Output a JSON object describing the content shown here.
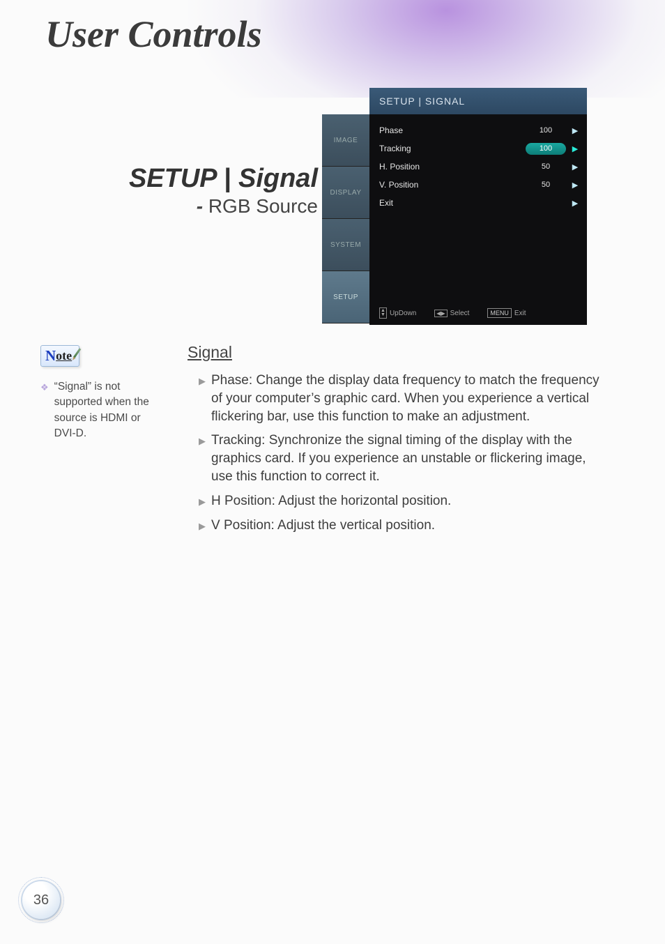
{
  "banner": {
    "title": "User Controls"
  },
  "section": {
    "heading": "SETUP | Signal",
    "sub_dash": "-",
    "sub": " RGB Source"
  },
  "osd": {
    "title": "SETUP | SIGNAL",
    "tabs": [
      "IMAGE",
      "DISPLAY",
      "SYSTEM",
      "SETUP"
    ],
    "rows": [
      {
        "label": "Phase",
        "value": "100",
        "highlight": false
      },
      {
        "label": "Tracking",
        "value": "100",
        "highlight": true
      },
      {
        "label": "H. Position",
        "value": "50",
        "highlight": false
      },
      {
        "label": "V. Position",
        "value": "50",
        "highlight": false
      },
      {
        "label": "Exit",
        "value": "",
        "highlight": false
      }
    ],
    "footer": {
      "updown": "UpDown",
      "select": "Select",
      "menu_key": "MENU",
      "exit": "Exit"
    }
  },
  "note": {
    "badge_n": "N",
    "badge_ote": "ote",
    "items": [
      "“Signal” is not supported when the source is HDMI or DVI-D."
    ]
  },
  "body": {
    "subhead": "Signal",
    "items": [
      {
        "label": "Phase",
        "text": ": Change the display data frequency to match the frequency of your computer’s graphic card. When you experience a vertical flickering bar, use this function to make an adjustment."
      },
      {
        "label": "Tracking",
        "text": ": Synchronize the signal timing of the display with the graphics card. If you experience an unstable or flickering image, use this function to correct it."
      },
      {
        "label": "H Position",
        "text": ": Adjust the horizontal position."
      },
      {
        "label": "V Position",
        "text": ": Adjust the vertical position."
      }
    ]
  },
  "page_number": "36"
}
